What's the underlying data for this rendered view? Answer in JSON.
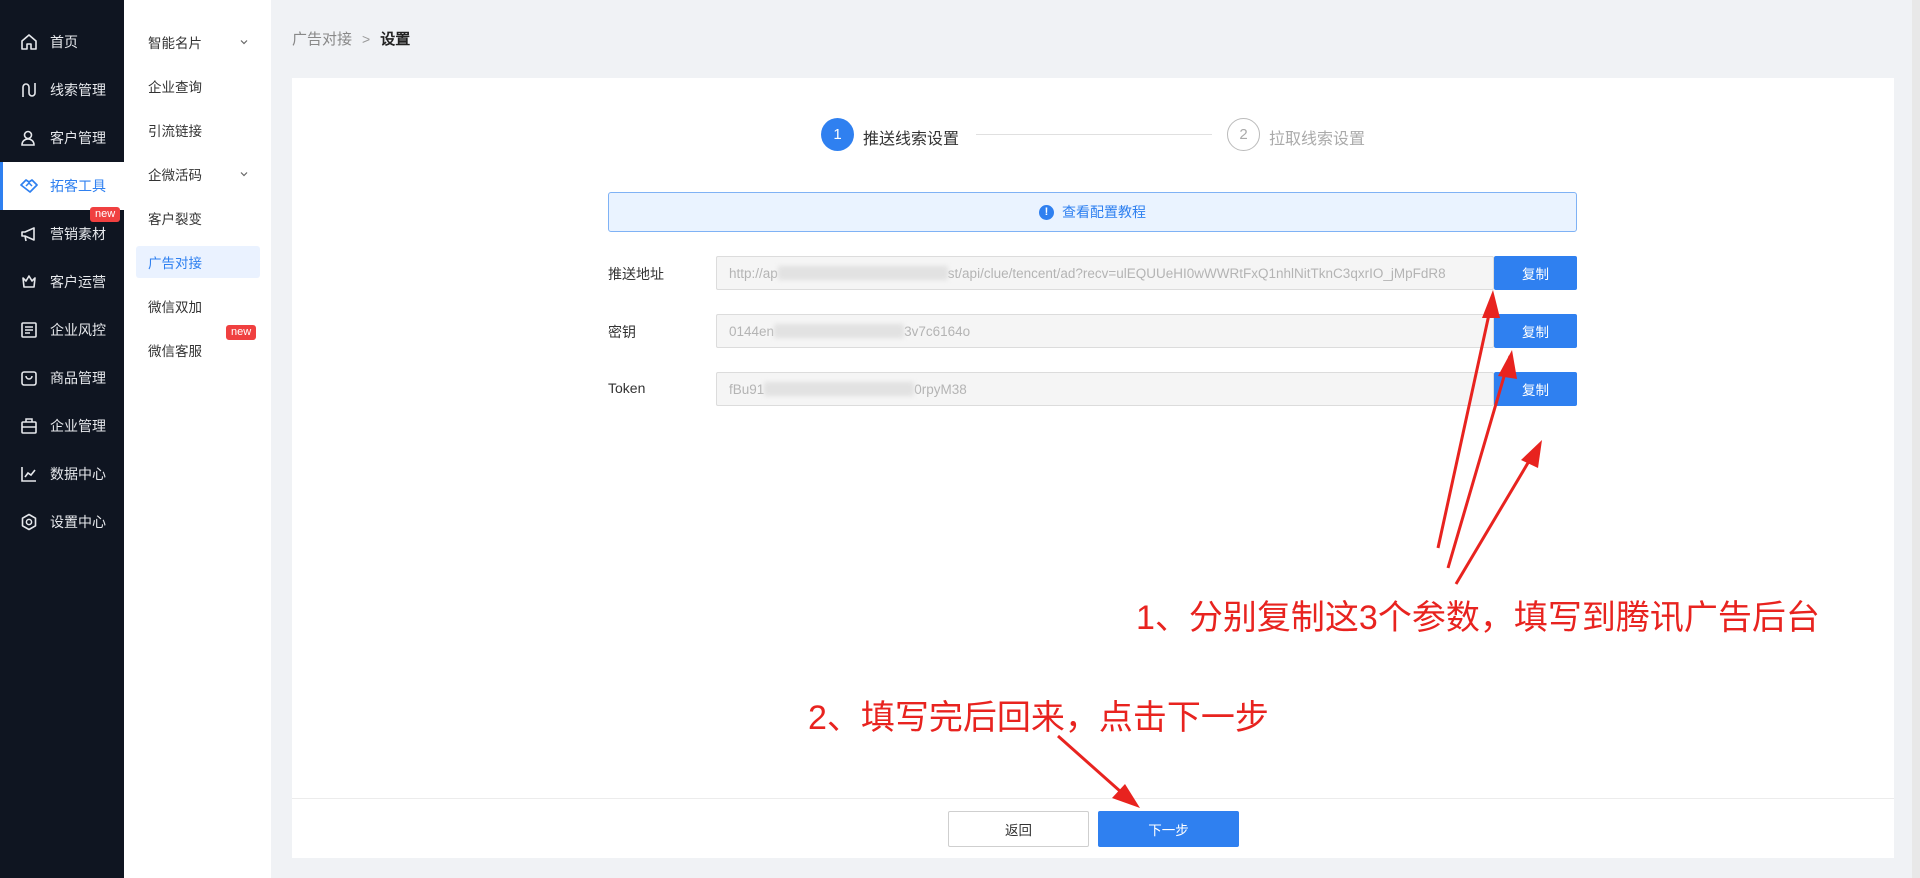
{
  "nav_primary": {
    "items": [
      {
        "label": "首页",
        "icon": "home-icon"
      },
      {
        "label": "线索管理",
        "icon": "route-icon"
      },
      {
        "label": "客户管理",
        "icon": "users-icon"
      },
      {
        "label": "拓客工具",
        "icon": "handshake-icon"
      },
      {
        "label": "营销素材",
        "icon": "megaphone-icon"
      },
      {
        "label": "客户运营",
        "icon": "crown-icon"
      },
      {
        "label": "企业风控",
        "icon": "list-icon"
      },
      {
        "label": "商品管理",
        "icon": "bag-icon"
      },
      {
        "label": "企业管理",
        "icon": "briefcase-icon"
      },
      {
        "label": "数据中心",
        "icon": "trend-icon"
      },
      {
        "label": "设置中心",
        "icon": "settings-icon"
      }
    ],
    "active": "拓客工具",
    "new_badge": "new"
  },
  "nav_secondary": {
    "items": [
      {
        "label": "智能名片"
      },
      {
        "label": "企业查询"
      },
      {
        "label": "引流链接"
      },
      {
        "label": "企微活码"
      },
      {
        "label": "客户裂变"
      },
      {
        "label": "广告对接"
      },
      {
        "label": "微信双加"
      },
      {
        "label": "微信客服"
      }
    ],
    "active": "广告对接",
    "new_badge": "new"
  },
  "breadcrumb": {
    "parent": "广告对接",
    "current": "设置"
  },
  "steps": [
    {
      "num": "1",
      "label": "推送线索设置",
      "status": "active"
    },
    {
      "num": "2",
      "label": "拉取线索设置",
      "status": "pending"
    }
  ],
  "notice": {
    "text": "查看配置教程"
  },
  "form": {
    "rows": [
      {
        "label": "推送地址",
        "value_start": "http://ap",
        "value_end": "st/api/clue/tencent/ad?recv=ulEQUUeHI0wWWRtFxQ1nhlNitTknC3qxrIO_jMpFdR8",
        "button": "复制"
      },
      {
        "label": "密钥",
        "value_start": "0144en",
        "value_end": "3v7c6164o",
        "button": "复制"
      },
      {
        "label": "Token",
        "value_start": "fBu91",
        "value_end": "0rpyM38",
        "button": "复制"
      }
    ]
  },
  "footer": {
    "back": "返回",
    "next": "下一步"
  },
  "annotations": {
    "a1": "1、分别复制这3个参数，填写到腾讯广告后台",
    "a2": "2、填写完后回来，点击下一步"
  },
  "colors": {
    "primary": "#2f80f0",
    "nav_bg": "#0f1521",
    "annotation": "#e8231f",
    "badge": "#f04040"
  }
}
